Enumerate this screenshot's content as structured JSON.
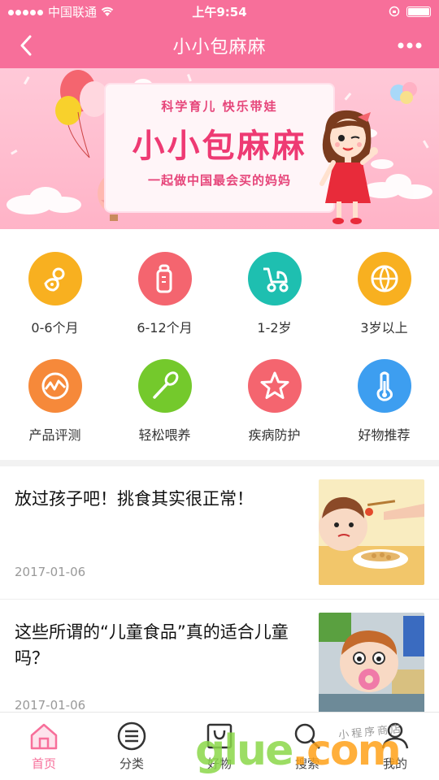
{
  "status_bar": {
    "carrier": "中国联通",
    "time": "上午9:54"
  },
  "navbar": {
    "title": "小小包麻麻"
  },
  "banner": {
    "subtitle": "科学育儿   快乐带娃",
    "title": "小小包麻麻",
    "slogan": "一起做中国最会买的妈妈"
  },
  "categories": [
    {
      "label": "0-6个月",
      "icon": "pacifier-icon",
      "color": "#f8b020"
    },
    {
      "label": "6-12个月",
      "icon": "baby-bottle-icon",
      "color": "#f4656f"
    },
    {
      "label": "1-2岁",
      "icon": "stroller-icon",
      "color": "#1ebfb0"
    },
    {
      "label": "3岁以上",
      "icon": "ball-icon",
      "color": "#f8b020"
    },
    {
      "label": "产品评测",
      "icon": "chart-icon",
      "color": "#f6893a"
    },
    {
      "label": "轻松喂养",
      "icon": "spoon-icon",
      "color": "#74c92c"
    },
    {
      "label": "疾病防护",
      "icon": "star-icon",
      "color": "#f4656f"
    },
    {
      "label": "好物推荐",
      "icon": "thermometer-icon",
      "color": "#3d9ef0"
    }
  ],
  "articles": [
    {
      "title": "放过孩子吧！挑食其实很正常！",
      "date": "2017-01-06"
    },
    {
      "title": "这些所谓的“儿童食品”真的适合儿童吗？",
      "date": "2017-01-06"
    }
  ],
  "tabs": [
    {
      "label": "首页",
      "icon": "home-icon",
      "active": true
    },
    {
      "label": "分类",
      "icon": "list-icon",
      "active": false
    },
    {
      "label": "好物",
      "icon": "bag-icon",
      "active": false
    },
    {
      "label": "搜索",
      "icon": "search-icon",
      "active": false
    },
    {
      "label": "我的",
      "icon": "user-icon",
      "active": false
    }
  ],
  "watermark": {
    "brand_a": "glue",
    "brand_b": ".com",
    "tag": "小程序商店"
  },
  "colors": {
    "brand": "#f76f9a",
    "active_tab": "#f76f9a"
  }
}
